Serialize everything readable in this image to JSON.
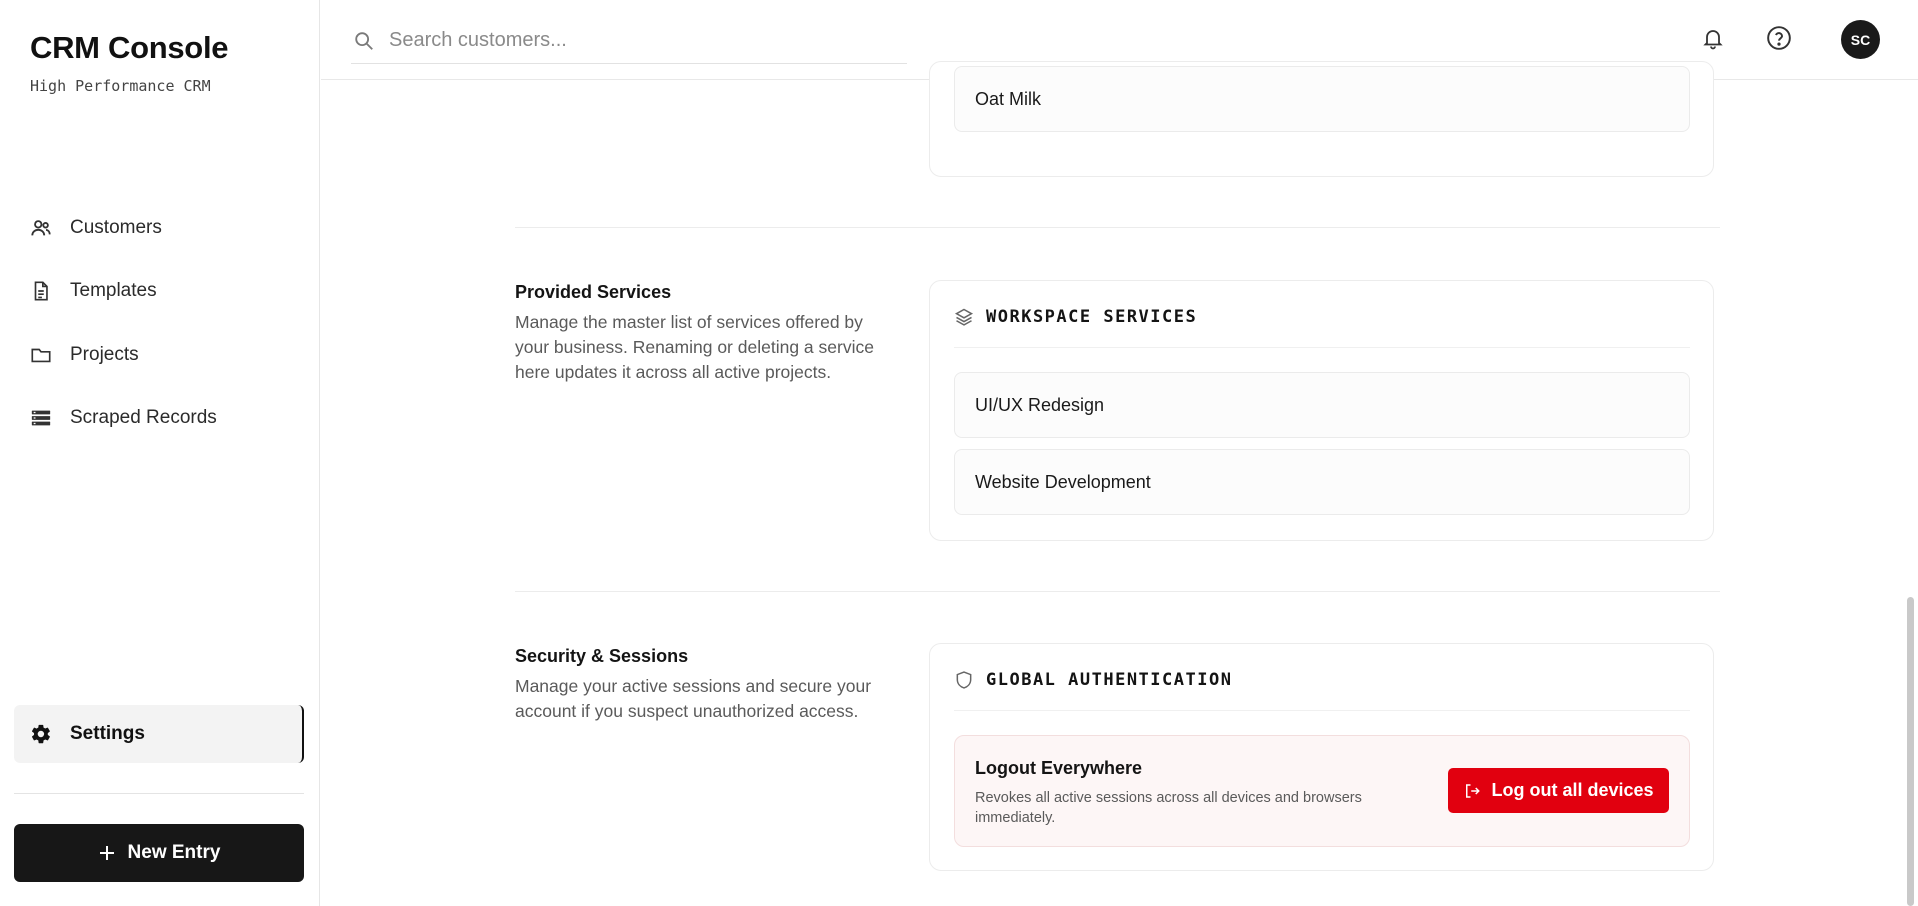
{
  "brand": {
    "title": "CRM Console",
    "subtitle": "High Performance CRM"
  },
  "sidebar": {
    "items": [
      {
        "label": "Customers",
        "icon": "users-icon"
      },
      {
        "label": "Templates",
        "icon": "document-icon"
      },
      {
        "label": "Projects",
        "icon": "folder-icon"
      },
      {
        "label": "Scraped Records",
        "icon": "database-icon"
      }
    ],
    "settings_label": "Settings",
    "new_entry_label": "New Entry"
  },
  "topbar": {
    "search_placeholder": "Search customers...",
    "avatar_initials": "SC"
  },
  "preferences": {
    "visible_item": "Oat Milk"
  },
  "services": {
    "title": "Provided Services",
    "description": "Manage the master list of services offered by your business. Renaming or deleting a service here updates it across all active projects.",
    "card_heading": "WORKSPACE SERVICES",
    "items": [
      "UI/UX Redesign",
      "Website Development"
    ]
  },
  "security": {
    "title": "Security & Sessions",
    "description": "Manage your active sessions and secure your account if you suspect unauthorized access.",
    "card_heading": "GLOBAL AUTHENTICATION",
    "logout_title": "Logout Everywhere",
    "logout_desc": "Revokes all active sessions across all devices and browsers immediately.",
    "logout_button": "Log out all devices"
  },
  "colors": {
    "accent_dark": "#171717",
    "danger": "#e1000f",
    "danger_bg": "#fdf6f6"
  }
}
